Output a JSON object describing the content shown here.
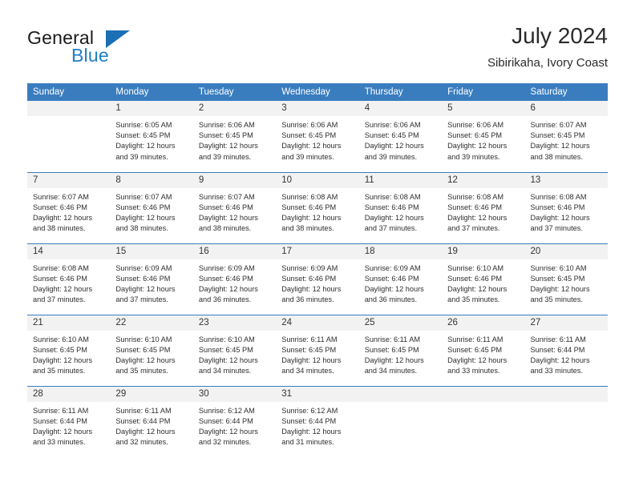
{
  "brand": {
    "word_one": "General",
    "word_two": "Blue",
    "icon": "triangle-logo-icon",
    "color_primary": "#1b6fb5",
    "color_text": "#1a1a1a"
  },
  "header": {
    "title": "July 2024",
    "subtitle": "Sibirikaha, Ivory Coast"
  },
  "theme": {
    "header_row_bg": "#3a7dbf",
    "daynum_bg": "#f2f2f2",
    "text": "#2e2e2e"
  },
  "calendar": {
    "weekday_headers": [
      "Sunday",
      "Monday",
      "Tuesday",
      "Wednesday",
      "Thursday",
      "Friday",
      "Saturday"
    ],
    "weeks": [
      [
        {
          "day": "",
          "details": ""
        },
        {
          "day": "1",
          "details": "Sunrise: 6:05 AM\nSunset: 6:45 PM\nDaylight: 12 hours\nand 39 minutes."
        },
        {
          "day": "2",
          "details": "Sunrise: 6:06 AM\nSunset: 6:45 PM\nDaylight: 12 hours\nand 39 minutes."
        },
        {
          "day": "3",
          "details": "Sunrise: 6:06 AM\nSunset: 6:45 PM\nDaylight: 12 hours\nand 39 minutes."
        },
        {
          "day": "4",
          "details": "Sunrise: 6:06 AM\nSunset: 6:45 PM\nDaylight: 12 hours\nand 39 minutes."
        },
        {
          "day": "5",
          "details": "Sunrise: 6:06 AM\nSunset: 6:45 PM\nDaylight: 12 hours\nand 39 minutes."
        },
        {
          "day": "6",
          "details": "Sunrise: 6:07 AM\nSunset: 6:45 PM\nDaylight: 12 hours\nand 38 minutes."
        }
      ],
      [
        {
          "day": "7",
          "details": "Sunrise: 6:07 AM\nSunset: 6:46 PM\nDaylight: 12 hours\nand 38 minutes."
        },
        {
          "day": "8",
          "details": "Sunrise: 6:07 AM\nSunset: 6:46 PM\nDaylight: 12 hours\nand 38 minutes."
        },
        {
          "day": "9",
          "details": "Sunrise: 6:07 AM\nSunset: 6:46 PM\nDaylight: 12 hours\nand 38 minutes."
        },
        {
          "day": "10",
          "details": "Sunrise: 6:08 AM\nSunset: 6:46 PM\nDaylight: 12 hours\nand 38 minutes."
        },
        {
          "day": "11",
          "details": "Sunrise: 6:08 AM\nSunset: 6:46 PM\nDaylight: 12 hours\nand 37 minutes."
        },
        {
          "day": "12",
          "details": "Sunrise: 6:08 AM\nSunset: 6:46 PM\nDaylight: 12 hours\nand 37 minutes."
        },
        {
          "day": "13",
          "details": "Sunrise: 6:08 AM\nSunset: 6:46 PM\nDaylight: 12 hours\nand 37 minutes."
        }
      ],
      [
        {
          "day": "14",
          "details": "Sunrise: 6:08 AM\nSunset: 6:46 PM\nDaylight: 12 hours\nand 37 minutes."
        },
        {
          "day": "15",
          "details": "Sunrise: 6:09 AM\nSunset: 6:46 PM\nDaylight: 12 hours\nand 37 minutes."
        },
        {
          "day": "16",
          "details": "Sunrise: 6:09 AM\nSunset: 6:46 PM\nDaylight: 12 hours\nand 36 minutes."
        },
        {
          "day": "17",
          "details": "Sunrise: 6:09 AM\nSunset: 6:46 PM\nDaylight: 12 hours\nand 36 minutes."
        },
        {
          "day": "18",
          "details": "Sunrise: 6:09 AM\nSunset: 6:46 PM\nDaylight: 12 hours\nand 36 minutes."
        },
        {
          "day": "19",
          "details": "Sunrise: 6:10 AM\nSunset: 6:46 PM\nDaylight: 12 hours\nand 35 minutes."
        },
        {
          "day": "20",
          "details": "Sunrise: 6:10 AM\nSunset: 6:45 PM\nDaylight: 12 hours\nand 35 minutes."
        }
      ],
      [
        {
          "day": "21",
          "details": "Sunrise: 6:10 AM\nSunset: 6:45 PM\nDaylight: 12 hours\nand 35 minutes."
        },
        {
          "day": "22",
          "details": "Sunrise: 6:10 AM\nSunset: 6:45 PM\nDaylight: 12 hours\nand 35 minutes."
        },
        {
          "day": "23",
          "details": "Sunrise: 6:10 AM\nSunset: 6:45 PM\nDaylight: 12 hours\nand 34 minutes."
        },
        {
          "day": "24",
          "details": "Sunrise: 6:11 AM\nSunset: 6:45 PM\nDaylight: 12 hours\nand 34 minutes."
        },
        {
          "day": "25",
          "details": "Sunrise: 6:11 AM\nSunset: 6:45 PM\nDaylight: 12 hours\nand 34 minutes."
        },
        {
          "day": "26",
          "details": "Sunrise: 6:11 AM\nSunset: 6:45 PM\nDaylight: 12 hours\nand 33 minutes."
        },
        {
          "day": "27",
          "details": "Sunrise: 6:11 AM\nSunset: 6:44 PM\nDaylight: 12 hours\nand 33 minutes."
        }
      ],
      [
        {
          "day": "28",
          "details": "Sunrise: 6:11 AM\nSunset: 6:44 PM\nDaylight: 12 hours\nand 33 minutes."
        },
        {
          "day": "29",
          "details": "Sunrise: 6:11 AM\nSunset: 6:44 PM\nDaylight: 12 hours\nand 32 minutes."
        },
        {
          "day": "30",
          "details": "Sunrise: 6:12 AM\nSunset: 6:44 PM\nDaylight: 12 hours\nand 32 minutes."
        },
        {
          "day": "31",
          "details": "Sunrise: 6:12 AM\nSunset: 6:44 PM\nDaylight: 12 hours\nand 31 minutes."
        },
        {
          "day": "",
          "details": ""
        },
        {
          "day": "",
          "details": ""
        },
        {
          "day": "",
          "details": ""
        }
      ]
    ]
  }
}
